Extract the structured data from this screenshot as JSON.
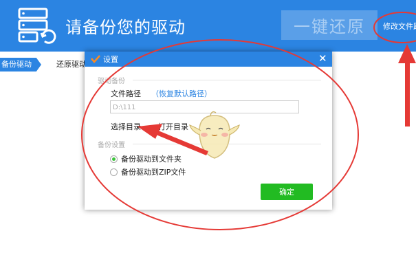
{
  "header": {
    "title": "请备份您的驱动",
    "restore_button": "一键还原",
    "modify_link": "修改文件路"
  },
  "tabs": {
    "backup": "备份驱动",
    "restore": "还原驱动"
  },
  "dialog": {
    "title": "设置",
    "close": "✕",
    "driver_backup": {
      "section_title": "驱动备份",
      "path_label": "文件路径",
      "reset_link": "（恢复默认路径）",
      "path_value": "D:\\111",
      "choose_dir": "选择目录",
      "open_dir": "打开目录"
    },
    "backup_settings": {
      "section_title": "备份设置",
      "option_folder": "备份驱动到文件夹",
      "option_zip": "备份驱动到ZIP文件",
      "selected": "folder"
    },
    "ok_button": "确定"
  },
  "colors": {
    "brand": "#2b84e2",
    "ok": "#22bb22",
    "annotation": "#e53935"
  },
  "icons": {
    "logo": "backup-restore-icon",
    "dialog_logo": "checkmark-logo-icon",
    "close": "close-icon",
    "mascot": "chick-mascot-icon"
  }
}
